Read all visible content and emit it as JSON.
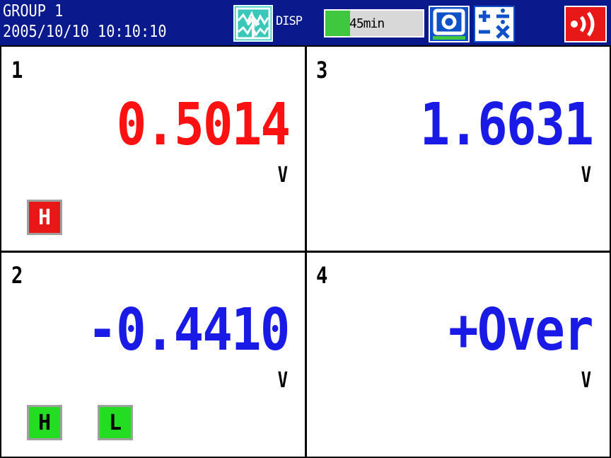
{
  "header": {
    "group_name": "GROUP 1",
    "datetime": "2005/10/10 10:10:10",
    "disp_label": "DISP",
    "disp_time": "45min",
    "disp_progress_fraction": 0.25
  },
  "colors": {
    "header_bg": "#0a1a8c",
    "red_value": "#ff1111",
    "blue_value": "#1a1ae6",
    "alarm_red": "#e81818",
    "alarm_green": "#22dd22"
  },
  "channels": [
    {
      "number": "1",
      "value": "0.5014",
      "unit": "V",
      "color": "#ff1111",
      "alarms": [
        {
          "label": "H",
          "state": "active-red"
        }
      ]
    },
    {
      "number": "3",
      "value": "1.6631",
      "unit": "V",
      "color": "#1a1ae6",
      "alarms": []
    },
    {
      "number": "2",
      "value": "-0.4410",
      "unit": "V",
      "color": "#1a1ae6",
      "alarms": [
        {
          "label": "H",
          "state": "green"
        },
        {
          "label": "L",
          "state": "green"
        }
      ]
    },
    {
      "number": "4",
      "value": "+Over",
      "unit": "V",
      "color": "#1a1ae6",
      "alarms": []
    }
  ],
  "icons": {
    "disp": "display-trend-icon",
    "snapshot": "snapshot-icon",
    "calc": "math-calc-icon",
    "alarm": "alarm-sound-icon"
  }
}
